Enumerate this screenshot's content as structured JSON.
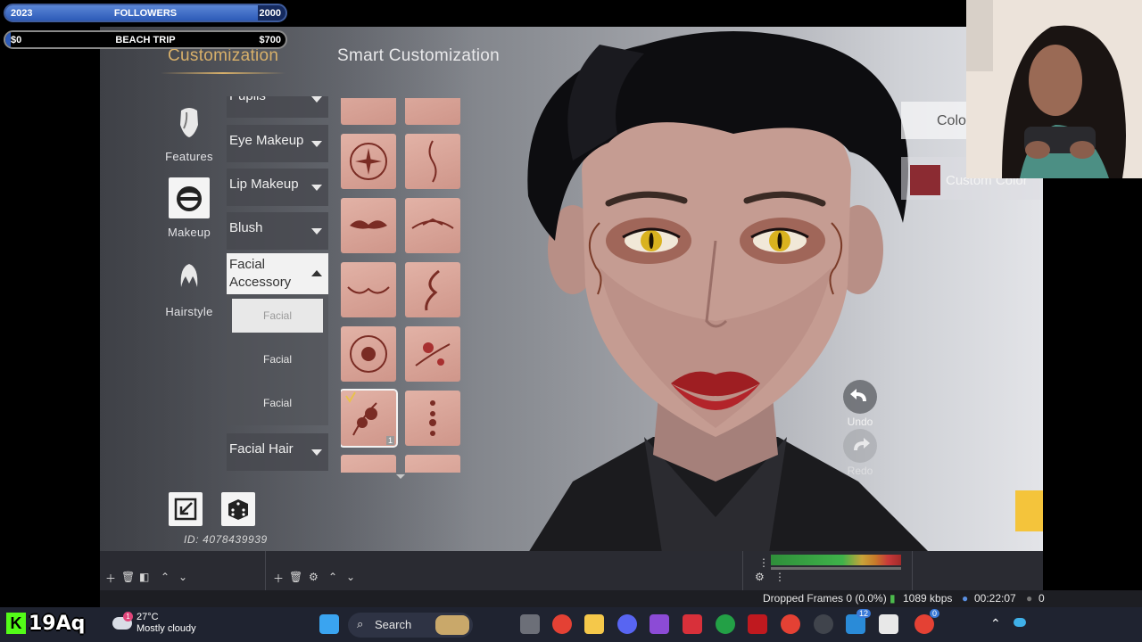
{
  "overlays": {
    "followers_bar": {
      "left": "2023",
      "center": "FOLLOWERS",
      "right": "2000",
      "progress": 0.9
    },
    "trip_bar": {
      "left": "$0",
      "center": "BEACH TRIP",
      "right": "$700",
      "progress": 0.02
    },
    "channel_badge": "19Aq",
    "channel_badge_letter": "K"
  },
  "game": {
    "tabs": [
      "Customization",
      "Smart Customization"
    ],
    "active_tab": "Customization",
    "categories": [
      {
        "label": "Features",
        "icon": "face-features-icon"
      },
      {
        "label": "Makeup",
        "icon": "makeup-icon",
        "selected": true
      },
      {
        "label": "Hairstyle",
        "icon": "hairstyle-icon"
      }
    ],
    "menu": [
      {
        "label": "Pupils"
      },
      {
        "label": "Eye Makeup"
      },
      {
        "label": "Lip Makeup"
      },
      {
        "label": "Blush"
      },
      {
        "label": "Facial Accessory",
        "open": true
      },
      {
        "label": "Facial Hair"
      }
    ],
    "submenu": [
      "Facial",
      "Facial",
      "Facial"
    ],
    "selected_submenu_index": 0,
    "selected_swatch_badge": "1",
    "color_button": "Colo",
    "custom_color_label": "Custom Color",
    "custom_color": "#8b2b32",
    "undo": "Undo",
    "redo": "Redo",
    "id_text": "ID: 4078439939"
  },
  "obs": {
    "dropped_frames": "Dropped Frames 0 (0.0%)",
    "bitrate": "1089 kbps",
    "time": "00:22:07",
    "trailing": "0"
  },
  "taskbar": {
    "temp": "27°C",
    "condition": "Mostly cloudy",
    "search": "Search",
    "weather_badge": "1",
    "badges": [
      "12",
      "0"
    ]
  }
}
